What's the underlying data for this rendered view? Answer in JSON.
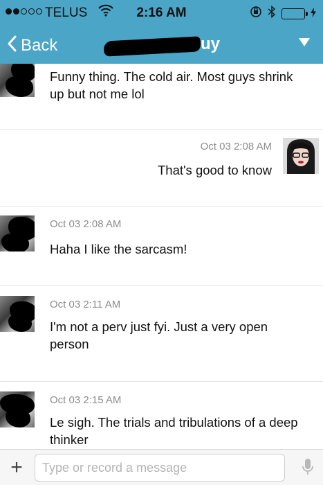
{
  "status_bar": {
    "carrier": "TELUS",
    "time": "2:16 AM",
    "signal_bars": 2,
    "battery_level": 0.1,
    "icons": [
      "signal-dots-icon",
      "wifi-icon",
      "orientation-lock-icon",
      "bluetooth-icon",
      "battery-icon"
    ]
  },
  "nav": {
    "back_label": "Back",
    "title_visible_suffix": "uy",
    "title_redacted": true,
    "dropdown_icon": "triangle-down-icon",
    "bar_color": "#4aa5c7"
  },
  "messages": [
    {
      "direction": "incoming",
      "timestamp": "",
      "text": "Funny thing. The cold air. Most guys shrink up but not me lol",
      "avatar": "redacted-avatar"
    },
    {
      "direction": "outgoing",
      "timestamp": "Oct 03 2:08 AM",
      "text": "That's good to know",
      "avatar": "user-photo-avatar"
    },
    {
      "direction": "incoming",
      "timestamp": "Oct 03 2:08 AM",
      "text": "Haha I like the sarcasm!",
      "avatar": "redacted-avatar"
    },
    {
      "direction": "incoming",
      "timestamp": "Oct 03 2:11 AM",
      "text": "I'm not a perv just fyi. Just a very open person",
      "avatar": "redacted-avatar"
    },
    {
      "direction": "incoming",
      "timestamp": "Oct 03 2:15 AM",
      "text": "Le sigh. The trials and tribulations of a deep thinker",
      "avatar": "redacted-avatar"
    }
  ],
  "composer": {
    "add_label": "+",
    "placeholder": "Type or record a message",
    "value": "",
    "mic_icon": "microphone-icon"
  }
}
